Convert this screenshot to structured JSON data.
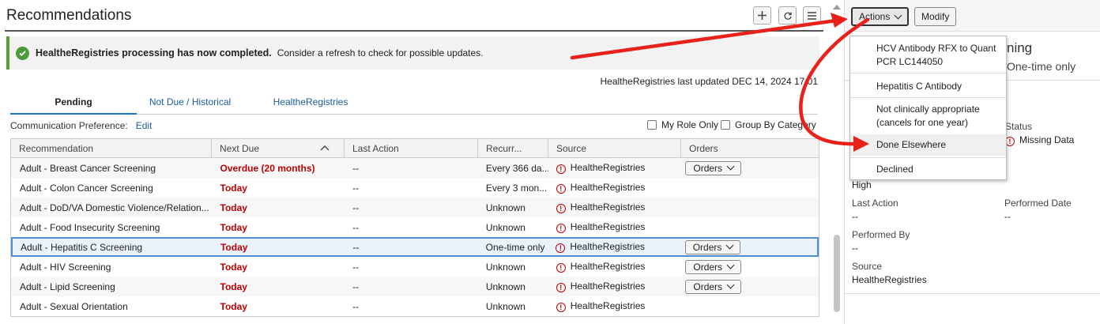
{
  "header": {
    "title": "Recommendations"
  },
  "banner": {
    "bold": "HealtheRegistries processing has now completed.",
    "text": "Consider a refresh to check for possible updates."
  },
  "last_updated": "HealtheRegistries last updated DEC 14, 2024 17:01",
  "tabs": [
    {
      "label": "Pending",
      "active": true
    },
    {
      "label": "Not Due / Historical",
      "active": false
    },
    {
      "label": "HealtheRegistries",
      "active": false
    }
  ],
  "communication": {
    "label": "Communication Preference:",
    "link": "Edit"
  },
  "filters": {
    "my_role_only": "My Role Only",
    "group_by_category": "Group By Category"
  },
  "table": {
    "columns": [
      "Recommendation",
      "Next Due",
      "Last Action",
      "Recurr...",
      "Source",
      "Orders"
    ],
    "rows": [
      {
        "rec": "Adult - Breast Cancer Screening",
        "due": "Overdue (20 months)",
        "last": "--",
        "recur": "Every 366 da...",
        "source": "HealtheRegistries",
        "orders": "Orders"
      },
      {
        "rec": "Adult - Colon Cancer Screening",
        "due": "Today",
        "last": "--",
        "recur": "Every 3 mon...",
        "source": "HealtheRegistries",
        "orders": ""
      },
      {
        "rec": "Adult - DoD/VA Domestic Violence/Relation...",
        "due": "Today",
        "last": "--",
        "recur": "Unknown",
        "source": "HealtheRegistries",
        "orders": ""
      },
      {
        "rec": "Adult - Food Insecurity Screening",
        "due": "Today",
        "last": "--",
        "recur": "Unknown",
        "source": "HealtheRegistries",
        "orders": ""
      },
      {
        "rec": "Adult - Hepatitis C Screening",
        "due": "Today",
        "last": "--",
        "recur": "One-time only",
        "source": "HealtheRegistries",
        "orders": "Orders",
        "selected": true
      },
      {
        "rec": "Adult - HIV Screening",
        "due": "Today",
        "last": "--",
        "recur": "Unknown",
        "source": "HealtheRegistries",
        "orders": "Orders"
      },
      {
        "rec": "Adult - Lipid Screening",
        "due": "Today",
        "last": "--",
        "recur": "Unknown",
        "source": "HealtheRegistries",
        "orders": "Orders"
      },
      {
        "rec": "Adult - Sexual Orientation",
        "due": "Today",
        "last": "--",
        "recur": "Unknown",
        "source": "HealtheRegistries",
        "orders": ""
      }
    ]
  },
  "detail": {
    "actions_label": "Actions",
    "modify_label": "Modify",
    "title_fragment": "ning",
    "recurrence_fragment": "One-time only",
    "status_label": "Status",
    "status_value": "Missing Data",
    "priority_value": "High",
    "last_action_label": "Last Action",
    "last_action_value": "--",
    "performed_date_label": "Performed Date",
    "performed_date_value": "--",
    "performed_by_label": "Performed By",
    "performed_by_value": "--",
    "source_label": "Source",
    "source_value": "HealtheRegistries"
  },
  "actions_menu": {
    "items": [
      "HCV Antibody RFX to Quant PCR LC144050",
      "Hepatitis C Antibody",
      "Not clinically appropriate (cancels for one year)",
      "Done Elsewhere",
      "Declined"
    ]
  },
  "colors": {
    "accent": "#1a72c4",
    "overdue": "#c00000",
    "success": "#4c9b3a",
    "annotation": "#e8211b"
  }
}
